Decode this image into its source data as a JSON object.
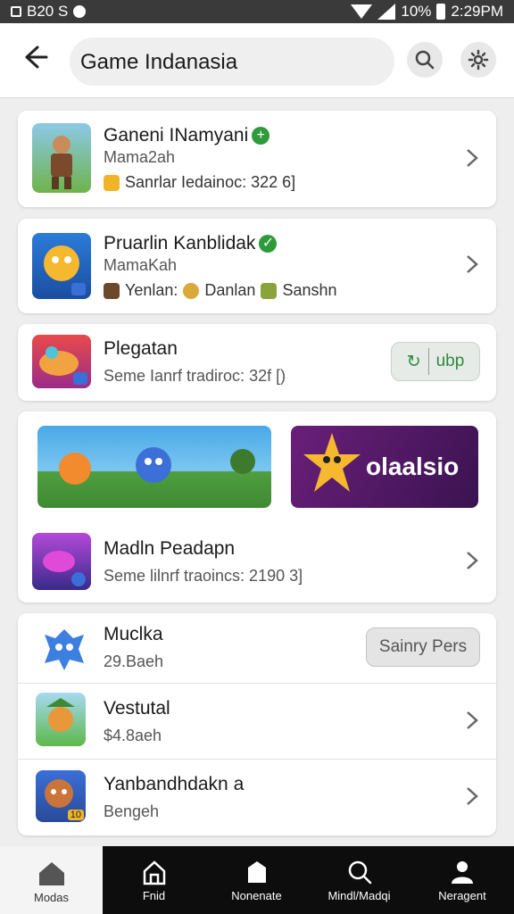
{
  "status_bar": {
    "left_text": "B20 S",
    "battery_text": "10%",
    "time": "2:29PM"
  },
  "header": {
    "back_icon": "back-arrow-icon",
    "search_text": "Game Indanasia",
    "search_icon": "search-icon",
    "settings_icon": "gear-icon"
  },
  "apps": [
    {
      "title": "Ganeni INamyani",
      "verified": true,
      "subtitle": "Mama2ah",
      "meta": "Sanrlar Iedainoc: 322 6]"
    },
    {
      "title": "Pruarlin Kanblidak",
      "verified": true,
      "subtitle": "MamaKah",
      "meta_items": [
        "Yenlan:",
        "Danlan",
        "Sanshn"
      ]
    },
    {
      "title": "Plegatan",
      "subtitle": "Seme Ianrf tradiroc: 32f [)",
      "button": "ubp"
    }
  ],
  "featured": {
    "banner_text": "olaalsio",
    "title": "Madln Peadapn",
    "subtitle": "Seme lilnrf traoincs: 2190 3]"
  },
  "list": [
    {
      "title": "Muclka",
      "subtitle": "29.Baeh",
      "button": "Sainry Pers"
    },
    {
      "title": "Vestutal",
      "subtitle": "$4.8aeh"
    },
    {
      "title": "Yanbandhdakn a",
      "subtitle": "Bengeh",
      "badge": "10"
    }
  ],
  "nav": [
    {
      "label": "Modas",
      "icon": "home-icon",
      "active": true
    },
    {
      "label": "Fnid",
      "icon": "store-icon",
      "active": false
    },
    {
      "label": "Nonenate",
      "icon": "bookmark-icon",
      "active": false
    },
    {
      "label": "Mindl/Madqi",
      "icon": "search-icon",
      "active": false
    },
    {
      "label": "Neragent",
      "icon": "person-icon",
      "active": false
    }
  ],
  "colors": {
    "accent_green": "#2e9b3a",
    "nav_bg": "#0d0d0d",
    "status_bg": "#3a3a3a"
  }
}
